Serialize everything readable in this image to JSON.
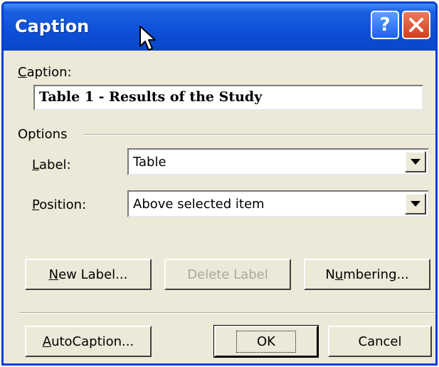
{
  "window": {
    "title": "Caption"
  },
  "titlebar_buttons": {
    "help_label": "?"
  },
  "caption": {
    "label_prefix": "",
    "label_underline": "C",
    "label_rest": "aption:",
    "value": "Table 1 - Results of the Study"
  },
  "options": {
    "section_label": "Options",
    "label_field": {
      "underline": "L",
      "rest": "abel:",
      "value": "Table"
    },
    "position_field": {
      "underline": "P",
      "rest": "osition:",
      "value": "Above selected item"
    }
  },
  "buttons": {
    "new_label": {
      "underline": "N",
      "rest": "ew Label..."
    },
    "delete_label": "Delete Label",
    "numbering": {
      "pre": "N",
      "underline": "u",
      "rest": "mbering..."
    },
    "autocaption": {
      "underline": "A",
      "rest": "utoCaption..."
    },
    "ok": "OK",
    "cancel": "Cancel"
  },
  "icons": {
    "help": "help-icon",
    "close": "close-icon",
    "cursor": "mouse-cursor-icon",
    "dropdown": "chevron-down-icon"
  }
}
